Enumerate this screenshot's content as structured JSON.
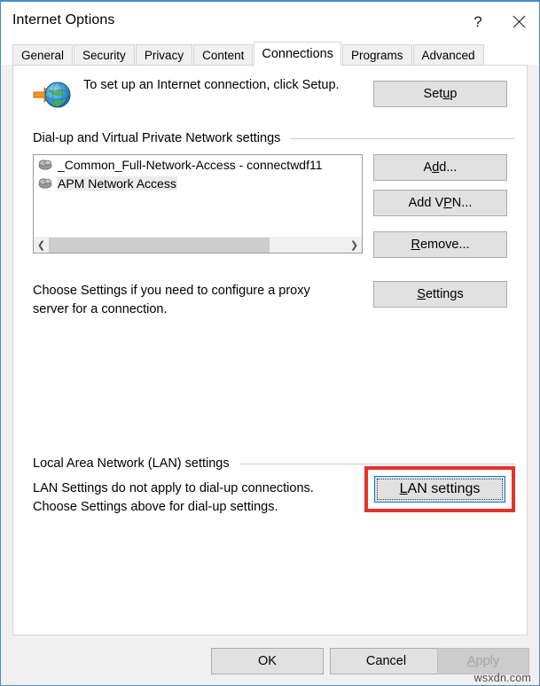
{
  "window": {
    "title": "Internet Options",
    "help_icon": "question-mark-icon",
    "close_icon": "close-icon",
    "border_color": "#4a8dc0"
  },
  "tabs": [
    {
      "label": "General",
      "active": false
    },
    {
      "label": "Security",
      "active": false
    },
    {
      "label": "Privacy",
      "active": false
    },
    {
      "label": "Content",
      "active": false
    },
    {
      "label": "Connections",
      "active": true
    },
    {
      "label": "Programs",
      "active": false
    },
    {
      "label": "Advanced",
      "active": false
    }
  ],
  "intro": {
    "icon": "globe-with-arrow-icon",
    "text": "To set up an Internet connection, click Setup.",
    "setup_button": {
      "label_before": "Set",
      "accel": "u",
      "label_after": "p",
      "full_label": "Setup"
    }
  },
  "dialup_group": {
    "label": "Dial-up and Virtual Private Network settings",
    "connections": [
      {
        "icon": "network-connection-icon",
        "label": "_Common_Full-Network-Access - connectwdf11",
        "selected": false
      },
      {
        "icon": "network-connection-icon",
        "label": "APM Network Access",
        "selected": true
      }
    ],
    "scrollbar": {
      "left_arrow": "chevron-left-icon",
      "right_arrow": "chevron-right-icon",
      "thumb_percent": 74
    },
    "buttons": [
      {
        "name": "add",
        "before": "A",
        "accel": "d",
        "after": "d...",
        "full_label": "Add..."
      },
      {
        "name": "add-vpn",
        "before": "Add V",
        "accel": "P",
        "after": "N...",
        "full_label": "Add VPN..."
      },
      {
        "name": "remove",
        "before": "",
        "accel": "R",
        "after": "emove...",
        "full_label": "Remove..."
      },
      {
        "name": "settings",
        "before": "",
        "accel": "S",
        "after": "ettings",
        "full_label": "Settings"
      }
    ],
    "proxy_hint": "Choose Settings if you need to configure a proxy server for a connection."
  },
  "lan_group": {
    "label": "Local Area Network (LAN) settings",
    "hint": "LAN Settings do not apply to dial-up connections.\nChoose Settings above for dial-up settings.",
    "lan_settings_button": {
      "before": "",
      "accel": "L",
      "after": "AN settings",
      "full_label": "LAN settings",
      "focused": true,
      "highlight_color": "#e8312a",
      "focus_border_color": "#0078d7"
    }
  },
  "footer": {
    "ok_label": "OK",
    "cancel_label": "Cancel",
    "apply": {
      "before": "",
      "accel": "A",
      "after": "pply",
      "full_label": "Apply",
      "disabled": true
    }
  },
  "watermark": "wsxdn.com"
}
